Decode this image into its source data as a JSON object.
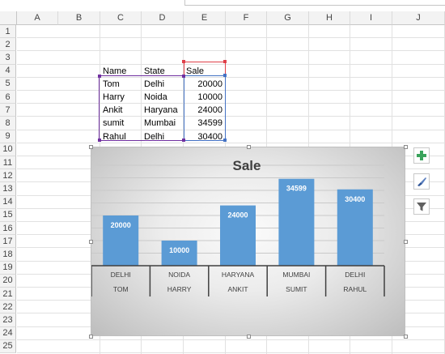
{
  "columns": [
    "A",
    "B",
    "C",
    "D",
    "E",
    "F",
    "G",
    "H",
    "I",
    "J"
  ],
  "rows": [
    "1",
    "2",
    "3",
    "4",
    "5",
    "6",
    "7",
    "8",
    "9",
    "10",
    "11",
    "12",
    "13",
    "14",
    "15",
    "16",
    "17",
    "18",
    "19",
    "20",
    "21",
    "22",
    "23",
    "24",
    "25"
  ],
  "table": {
    "headers": [
      "Name",
      "State",
      "Sale"
    ],
    "rows": [
      [
        "Tom",
        "Delhi",
        "20000"
      ],
      [
        "Harry",
        "Noida",
        "10000"
      ],
      [
        "Ankit",
        "Haryana",
        "24000"
      ],
      [
        "sumit",
        "Mumbai",
        "34599"
      ],
      [
        "Rahul",
        "Delhi",
        "30400"
      ]
    ]
  },
  "chart_data": {
    "type": "bar",
    "title": "Sale",
    "categories": [
      [
        "DELHI",
        "TOM"
      ],
      [
        "NOIDA",
        "HARRY"
      ],
      [
        "HARYANA",
        "ANKIT"
      ],
      [
        "MUMBAI",
        "SUMIT"
      ],
      [
        "DELHI",
        "RAHUL"
      ]
    ],
    "values": [
      20000,
      10000,
      24000,
      34599,
      30400
    ],
    "value_labels": [
      "20000",
      "10000",
      "24000",
      "34599",
      "30400"
    ],
    "ylim": [
      0,
      40000
    ],
    "grid": true,
    "bar_color": "#5b9bd5"
  },
  "chart_tools": {
    "elements": "chart-elements-plus-icon",
    "styles": "chart-styles-brush-icon",
    "filters": "chart-filters-funnel-icon"
  },
  "colors": {
    "name_range": "#7030a0",
    "state_range": "#7030a0",
    "sale_header": "#e0404a",
    "sale_values": "#4472c4"
  }
}
